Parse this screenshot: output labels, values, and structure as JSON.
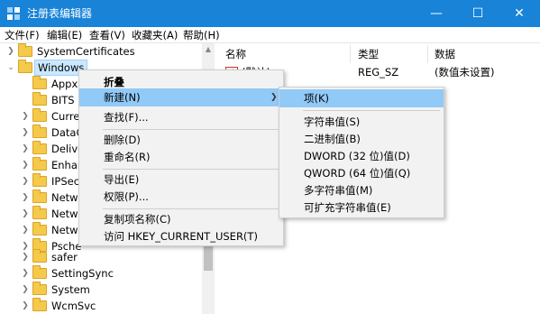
{
  "window": {
    "title": "注册表编辑器",
    "minimize_glyph": "—",
    "maximize_glyph": "☐",
    "close_glyph": "✕",
    "accent_color": "#1883d7"
  },
  "menubar": [
    "文件(F)",
    "编辑(E)",
    "查看(V)",
    "收藏夹(A)",
    "帮助(H)"
  ],
  "tree": {
    "items": [
      {
        "label": "SystemCertificates",
        "expanded": false,
        "selected": false
      },
      {
        "label": "Windows",
        "expanded": true,
        "selected": true
      },
      {
        "label": "Appx",
        "expanded": false,
        "selected": false
      },
      {
        "label": "BITS",
        "expanded": false,
        "selected": false
      },
      {
        "label": "Curre",
        "expanded": false,
        "selected": false
      },
      {
        "label": "DataC",
        "expanded": false,
        "selected": false
      },
      {
        "label": "Delive",
        "expanded": false,
        "selected": false
      },
      {
        "label": "Enhar",
        "expanded": false,
        "selected": false
      },
      {
        "label": "IPSec",
        "expanded": false,
        "selected": false
      },
      {
        "label": "Netwo",
        "expanded": false,
        "selected": false
      },
      {
        "label": "Netwo",
        "expanded": false,
        "selected": false
      },
      {
        "label": "Netwo",
        "expanded": false,
        "selected": false
      },
      {
        "label": "Psche",
        "expanded": false,
        "selected": false
      },
      {
        "label": "safer",
        "expanded": false,
        "selected": false
      },
      {
        "label": "SettingSync",
        "expanded": false,
        "selected": false
      },
      {
        "label": "System",
        "expanded": false,
        "selected": false
      },
      {
        "label": "WcmSvc",
        "expanded": false,
        "selected": false
      }
    ]
  },
  "values_pane": {
    "headers": {
      "name": "名称",
      "type": "类型",
      "data": "数据"
    },
    "rows": [
      {
        "name": "(默认)",
        "type": "REG_SZ",
        "data": "(数值未设置)",
        "icon": "string-value-icon"
      }
    ]
  },
  "context_menu": {
    "items": [
      {
        "label": "折叠",
        "bold": true
      },
      {
        "label": "新建(N)",
        "submenu": true,
        "highlighted": true
      },
      {
        "label": "查找(F)..."
      },
      {
        "label": "删除(D)"
      },
      {
        "label": "重命名(R)"
      },
      {
        "label": "导出(E)"
      },
      {
        "label": "权限(P)..."
      },
      {
        "label": "复制项名称(C)"
      },
      {
        "label": "访问 HKEY_CURRENT_USER(T)"
      }
    ]
  },
  "submenu": {
    "items": [
      {
        "label": "项(K)",
        "highlighted": true
      },
      {
        "label": "字符串值(S)"
      },
      {
        "label": "二进制值(B)"
      },
      {
        "label": "DWORD (32 位)值(D)"
      },
      {
        "label": "QWORD (64 位)值(Q)"
      },
      {
        "label": "多字符串值(M)"
      },
      {
        "label": "可扩充字符串值(E)"
      }
    ]
  }
}
